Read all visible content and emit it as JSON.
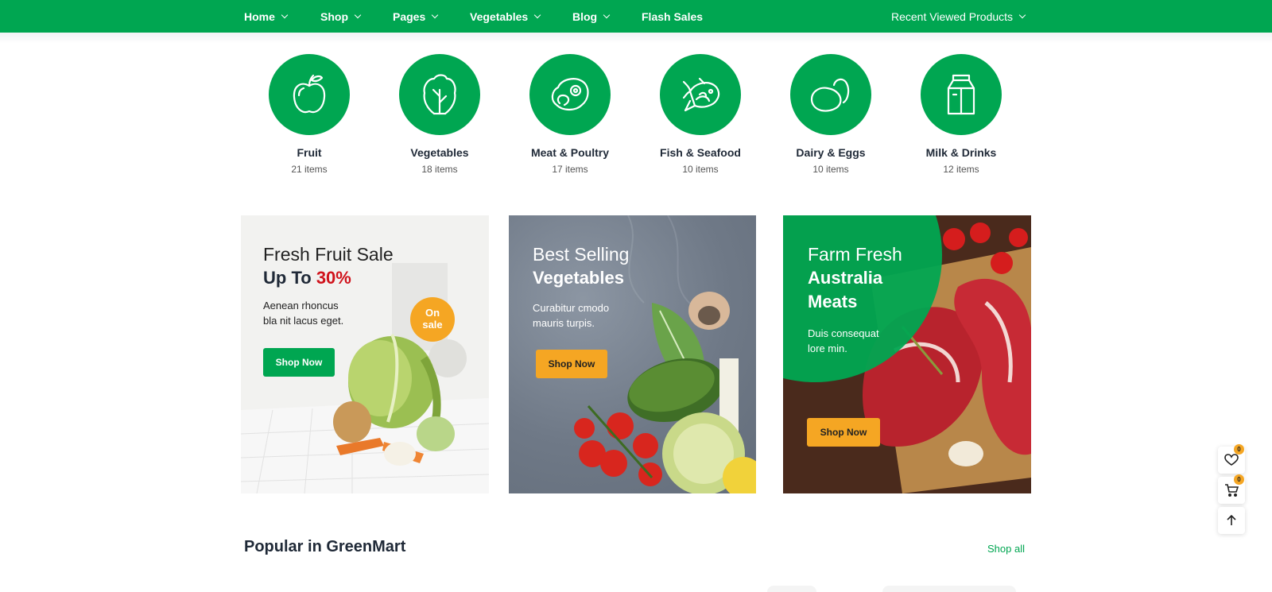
{
  "nav": {
    "items": [
      {
        "label": "Home"
      },
      {
        "label": "Shop"
      },
      {
        "label": "Pages"
      },
      {
        "label": "Vegetables"
      },
      {
        "label": "Blog"
      },
      {
        "label": "Flash Sales"
      }
    ],
    "recent": "Recent Viewed Products"
  },
  "categories": [
    {
      "name": "Fruit",
      "count": "21 items",
      "icon": "apple-icon"
    },
    {
      "name": "Vegetables",
      "count": "18 items",
      "icon": "lettuce-icon"
    },
    {
      "name": "Meat & Poultry",
      "count": "17 items",
      "icon": "steak-icon"
    },
    {
      "name": "Fish & Seafood",
      "count": "10 items",
      "icon": "fish-icon"
    },
    {
      "name": "Dairy & Eggs",
      "count": "10 items",
      "icon": "eggs-icon"
    },
    {
      "name": "Milk & Drinks",
      "count": "12 items",
      "icon": "milk-carton-icon"
    }
  ],
  "banners": [
    {
      "title_line1": "Fresh Fruit Sale",
      "title_bold": "Up To",
      "highlight": "30%",
      "text_line1": "Aenean rhoncus",
      "text_line2": "bla nit lacus eget.",
      "button": "Shop Now",
      "badge_line1": "On",
      "badge_line2": "sale"
    },
    {
      "title_line1": "Best Selling",
      "title_bold": "Vegetables",
      "text_line1": "Curabitur cmodo",
      "text_line2": "mauris turpis.",
      "button": "Shop Now"
    },
    {
      "title_line1": "Farm Fresh",
      "title_bold_line1": "Australia",
      "title_bold_line2": "Meats",
      "text_line1": "Duis consequat",
      "text_line2": "lore min.",
      "button": "Shop Now"
    }
  ],
  "floating": {
    "wishlist_count": "0",
    "cart_count": "0"
  },
  "popular": {
    "title": "Popular in GreenMart",
    "shop_all": "Shop all"
  },
  "colors": {
    "brand_green": "#00a651",
    "accent_orange": "#f5a623",
    "highlight_red": "#d0121b"
  }
}
